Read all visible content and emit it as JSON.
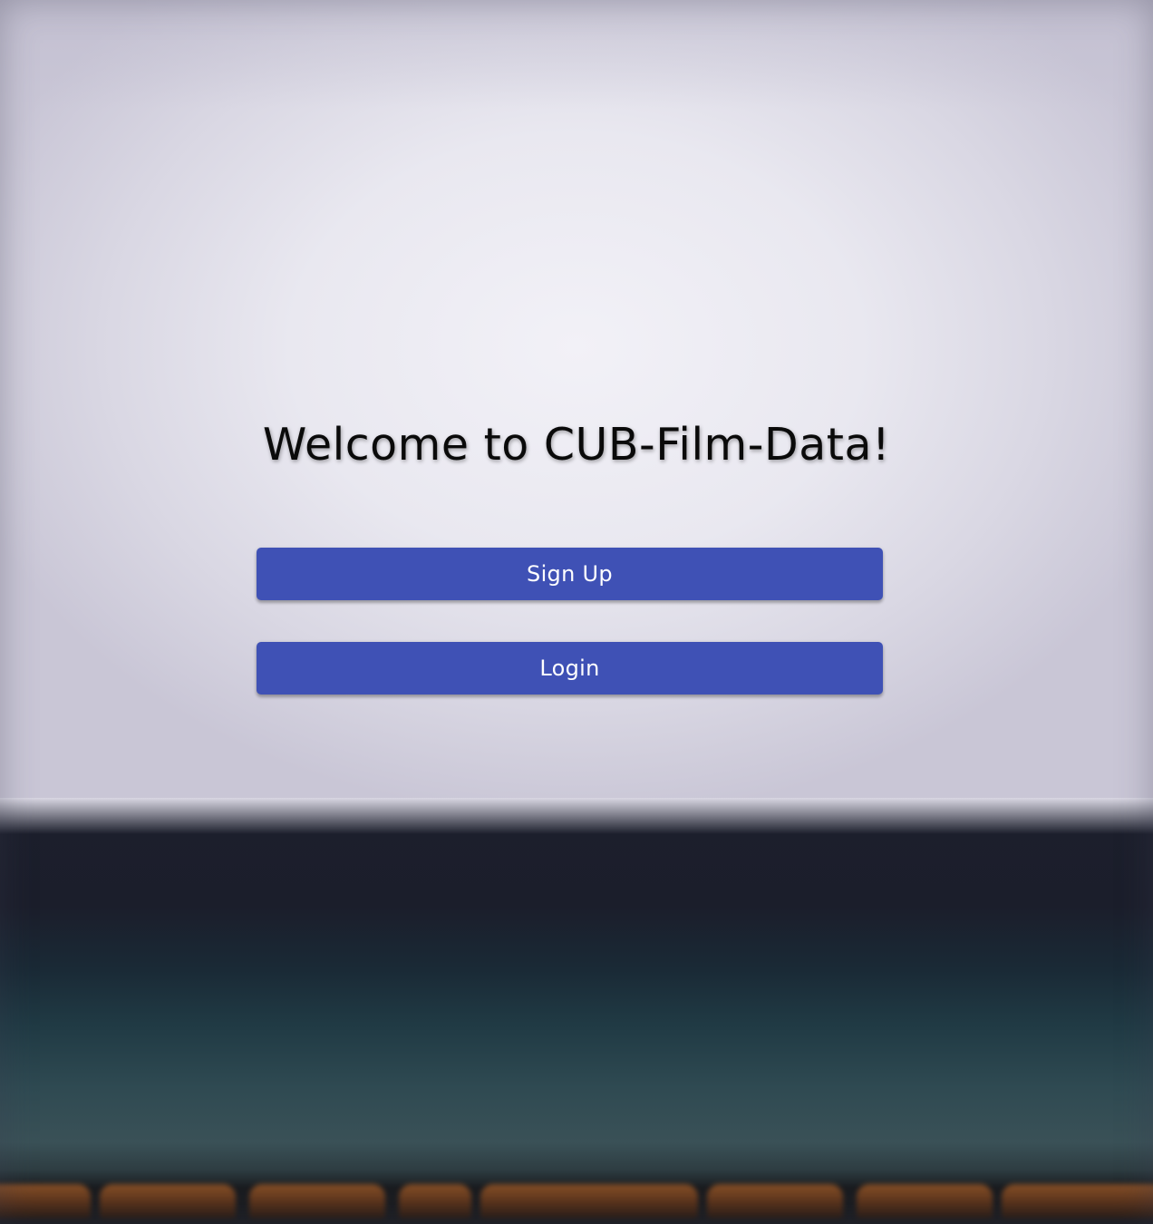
{
  "welcome": {
    "title": "Welcome to CUB-Film-Data!"
  },
  "actions": {
    "signup_label": "Sign Up",
    "login_label": "Login"
  },
  "colors": {
    "button_bg": "#3f51b5",
    "button_text": "#ffffff",
    "title_text": "#0a0a0a"
  }
}
